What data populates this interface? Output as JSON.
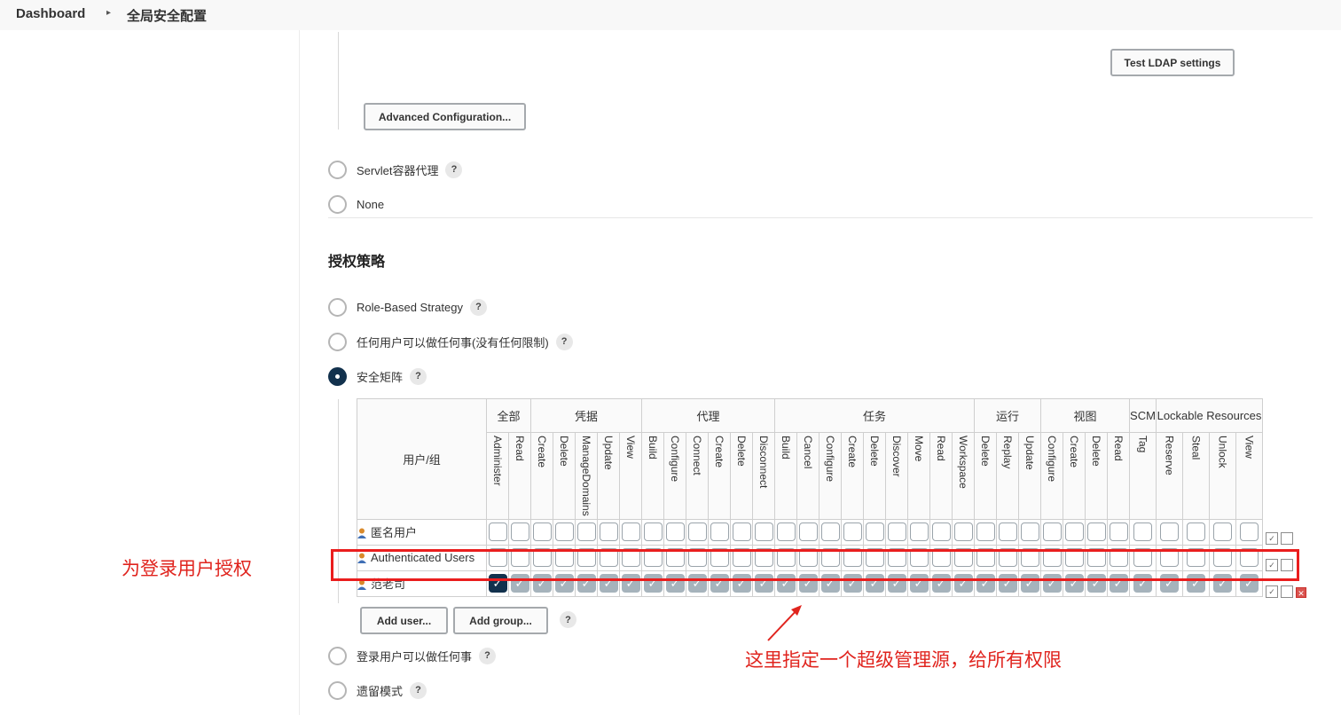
{
  "breadcrumb": {
    "home": "Dashboard",
    "current": "全局安全配置"
  },
  "ldap": {
    "test_button": "Test LDAP settings",
    "advanced_button": "Advanced Configuration..."
  },
  "security_realm": {
    "options": [
      {
        "label": "Servlet容器代理",
        "help": "?",
        "checked": false
      },
      {
        "label": "None",
        "help": "",
        "checked": false
      }
    ]
  },
  "authorization": {
    "title": "授权策略",
    "options_top": [
      {
        "label": "Role-Based Strategy",
        "help": "?",
        "checked": false
      },
      {
        "label": "任何用户可以做任何事(没有任何限制)",
        "help": "?",
        "checked": false
      },
      {
        "label": "安全矩阵",
        "help": "?",
        "checked": true
      }
    ],
    "options_bottom": [
      {
        "label": "登录用户可以做任何事",
        "help": "?",
        "checked": false
      },
      {
        "label": "遗留模式",
        "help": "?",
        "checked": false
      }
    ]
  },
  "matrix": {
    "user_group_header": "用户/组",
    "groups": [
      {
        "name": "全部",
        "span": 2
      },
      {
        "name": "凭据",
        "span": 5
      },
      {
        "name": "代理",
        "span": 6
      },
      {
        "name": "任务",
        "span": 9
      },
      {
        "name": "运行",
        "span": 3
      },
      {
        "name": "视图",
        "span": 4
      },
      {
        "name": "SCM",
        "span": 1
      },
      {
        "name": "Lockable Resources",
        "span": 4
      }
    ],
    "permissions": [
      "Administer",
      "Read",
      "Create",
      "Delete",
      "ManageDomains",
      "Update",
      "View",
      "Build",
      "Configure",
      "Connect",
      "Create",
      "Delete",
      "Disconnect",
      "Build",
      "Cancel",
      "Configure",
      "Create",
      "Delete",
      "Discover",
      "Move",
      "Read",
      "Workspace",
      "Delete",
      "Replay",
      "Update",
      "Configure",
      "Create",
      "Delete",
      "Read",
      "Tag",
      "Reserve",
      "Steal",
      "Unlock",
      "View"
    ],
    "rows": [
      {
        "name": "匿名用户",
        "all_checked": false,
        "removable": false
      },
      {
        "name": "Authenticated Users",
        "all_checked": false,
        "removable": false
      },
      {
        "name": "范老司",
        "all_checked": true,
        "removable": true
      }
    ],
    "add_user_button": "Add user...",
    "add_group_button": "Add group...",
    "help": "?"
  },
  "annotations": {
    "left_note": "为登录用户授权",
    "bottom_note": "这里指定一个超级管理源，给所有权限"
  },
  "colors": {
    "annotation_red": "#e0241e",
    "checked_admin": "#12314d",
    "checked_other": "#a6b3bc"
  }
}
